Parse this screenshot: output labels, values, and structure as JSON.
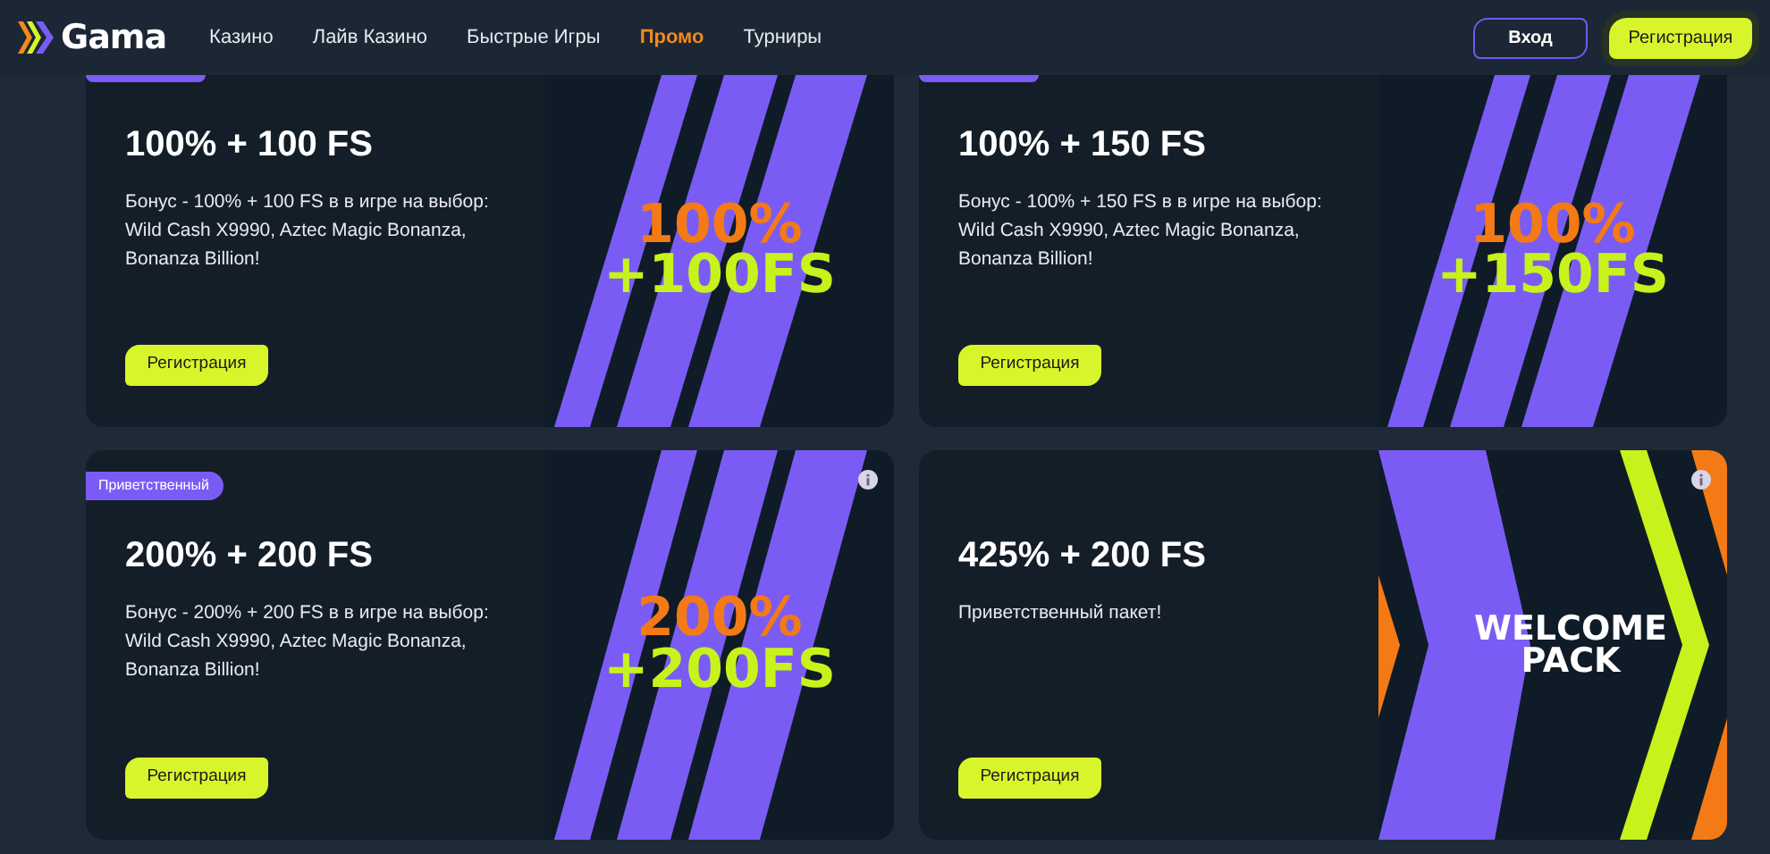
{
  "header": {
    "logo": "Gama",
    "nav": [
      {
        "label": "Казино",
        "selected": false
      },
      {
        "label": "Лайв Казино",
        "selected": false
      },
      {
        "label": "Быстрые Игры",
        "selected": false
      },
      {
        "label": "Промо",
        "selected": true
      },
      {
        "label": "Турниры",
        "selected": false
      }
    ],
    "login": "Вход",
    "register": "Регистрация"
  },
  "promos": [
    {
      "cut_top": true,
      "title": "100% + 100 FS",
      "description": "Бонус - 100% + 100 FS в в игре на выбор: Wild Cash X9990, Aztec Magic Bonanza, Bonanza Billion!",
      "button": "Регистрация",
      "art": {
        "kind": "stripes",
        "line1": "100%",
        "line2": "+100FS"
      }
    },
    {
      "cut_top": true,
      "title": "100% + 150 FS",
      "description": "Бонус - 100% + 150 FS в в игре на выбор: Wild Cash X9990, Aztec Magic Bonanza, Bonanza Billion!",
      "button": "Регистрация",
      "art": {
        "kind": "stripes",
        "line1": "100%",
        "line2": "+150FS"
      }
    },
    {
      "cut_top": false,
      "badge": "Приветственный",
      "info": true,
      "title": "200% + 200 FS",
      "description": "Бонус - 200% + 200 FS в в игре на выбор: Wild Cash X9990, Aztec Magic Bonanza, Bonanza Billion!",
      "button": "Регистрация",
      "art": {
        "kind": "stripes",
        "line1": "200%",
        "line2": "+200FS"
      }
    },
    {
      "cut_top": false,
      "info": true,
      "title": "425% + 200 FS",
      "description": "Приветственный пакет!",
      "button": "Регистрация",
      "art": {
        "kind": "chevrons",
        "line1": "WELCOME",
        "line2": "PACK"
      }
    }
  ]
}
